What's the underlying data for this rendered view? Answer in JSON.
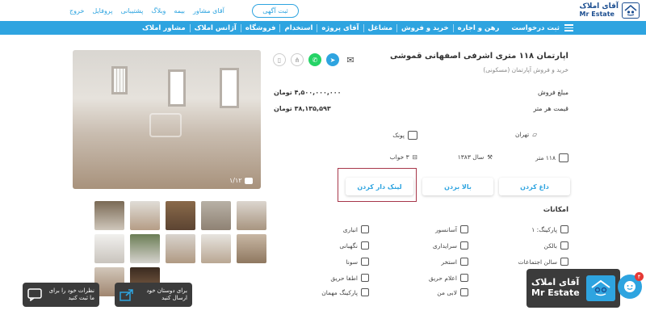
{
  "header": {
    "logo_fa": "آقای املاک",
    "logo_en": "Mr Estate",
    "post_ad": "ثبت آگهی",
    "top_links": [
      "آقای مشاور",
      "بیمه",
      "وبلاگ",
      "پشتیبانی",
      "پروفایل",
      "خروج"
    ]
  },
  "nav": {
    "request": "ثبت درخواست",
    "items": [
      "رهن و اجاره",
      "خرید و فروش",
      "مشاغل",
      "آقای پروژه",
      "استخدام",
      "فروشگاه",
      "آژانس املاک",
      "مشاور املاک"
    ]
  },
  "listing": {
    "title": "اپارتمان ۱۱۸ متری اشرفی اصفهانی قموشی",
    "subtitle": "خرید و فروش آپارتمان (مسکونی)",
    "photo_counter": "۱/۱۲",
    "sale_label": "مبلغ فروش",
    "sale_value": "۴,۵۰۰,۰۰۰,۰۰۰ تومان",
    "per_meter_label": "قیمت هر متر",
    "per_meter_value": "۳۸,۱۳۵,۵۹۳ تومان",
    "city": "تهران",
    "district": "پونک",
    "area": "۱۱۸ متر",
    "year": "سال ۱۳۸۳",
    "rooms": "۳ خواب"
  },
  "actions": {
    "hot": "داغ کردن",
    "top": "بالا بردن",
    "link": "لینک دار کردن"
  },
  "amenities": {
    "title": "امکانات",
    "col1": [
      "پارکینگ: ۱",
      "بالکن",
      "سالن اجتماعات"
    ],
    "col2": [
      "آسانسور",
      "سرایداری",
      "استخر",
      "اعلام حریق",
      "لابی من"
    ],
    "col3": [
      "انباری",
      "نگهبانی",
      "سونا",
      "اطفا حریق",
      "پارکینگ مهمان"
    ]
  },
  "share": {
    "friends": "برای دوستان خود ارسال کنید",
    "feedback": "نظرات خود را برای ما ثبت کنید"
  },
  "brand": {
    "fa": "آقای املاک",
    "en": "Mr Estate"
  },
  "chat_badge": "۴",
  "colors": {
    "primary": "#2ea4e0",
    "brand_dark": "#1d4f91",
    "highlight": "#a7374a",
    "whatsapp": "#25d366",
    "telegram": "#2ea4e0"
  }
}
